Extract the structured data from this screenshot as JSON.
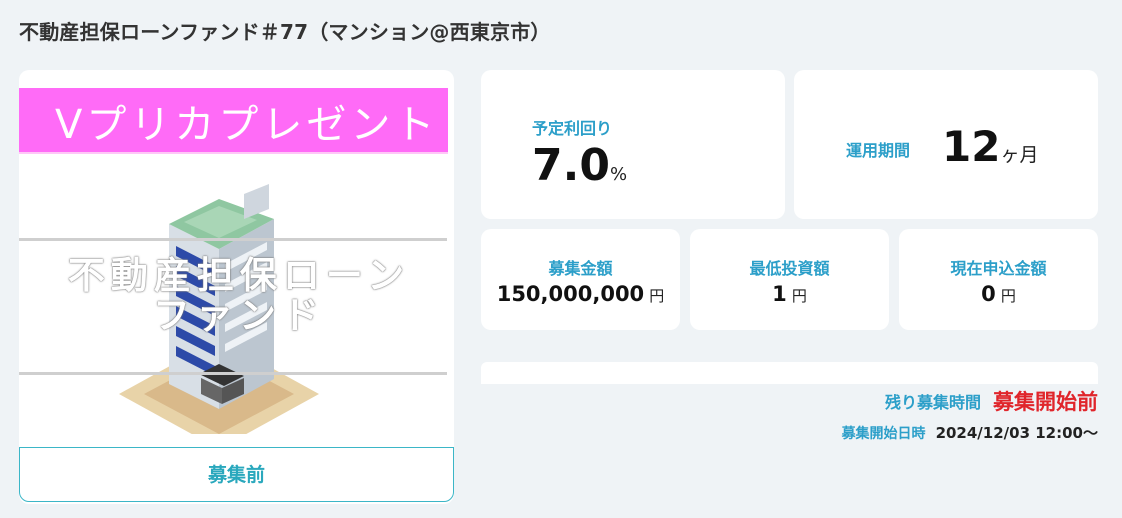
{
  "page": {
    "title": "不動産担保ローンファンド＃77（マンション@西東京市）"
  },
  "image_card": {
    "banner_text": "Vプリカプレゼント",
    "overlay_text_line1": "不動産担保ローン",
    "overlay_text_line2": "ファンド",
    "status_label": "募集前"
  },
  "stats": {
    "yield": {
      "label": "予定利回り",
      "value": "7.0",
      "unit": "%"
    },
    "period": {
      "label": "運用期間",
      "value": "12",
      "unit": "ヶ月"
    },
    "amount": {
      "label": "募集金額",
      "value": "150,000,000",
      "unit": "円"
    },
    "min_invest": {
      "label": "最低投資額",
      "value": "1",
      "unit": "円"
    },
    "current_applied": {
      "label": "現在申込金額",
      "value": "0",
      "unit": "円"
    }
  },
  "progress": {
    "percent": 0
  },
  "schedule": {
    "remaining_label": "残り募集時間",
    "remaining_value": "募集開始前",
    "start_label": "募集開始日時",
    "start_value": "2024/12/03 12:00〜"
  },
  "colors": {
    "accent_blue": "#2c9fc9",
    "banner_pink": "#ff6bf7",
    "alert_red": "#e0252b",
    "background": "#eff3f6"
  },
  "icons": {
    "building_illustration": "building-icon"
  }
}
